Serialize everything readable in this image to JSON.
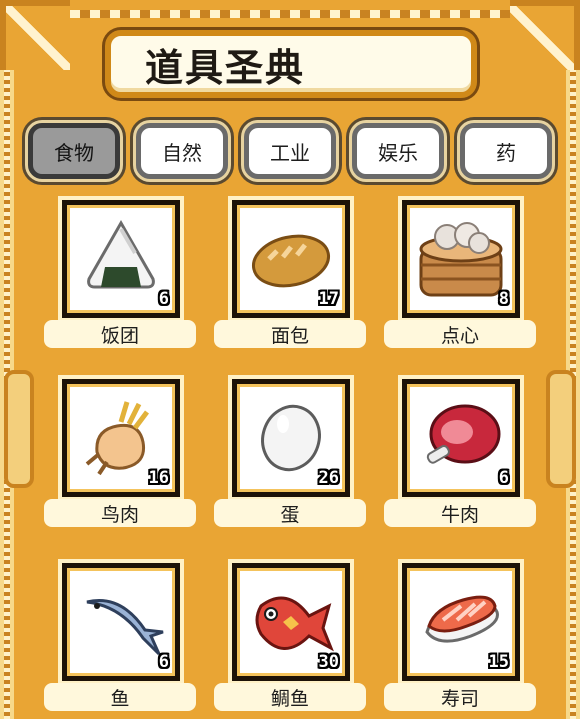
{
  "title": "道具圣典",
  "tabs": [
    {
      "label": "食物",
      "active": true
    },
    {
      "label": "自然",
      "active": false
    },
    {
      "label": "工业",
      "active": false
    },
    {
      "label": "娱乐",
      "active": false
    },
    {
      "label": "药",
      "active": false
    }
  ],
  "items": [
    {
      "name": "饭团",
      "count": "6",
      "icon": "rice-ball-icon"
    },
    {
      "name": "面包",
      "count": "17",
      "icon": "bread-icon"
    },
    {
      "name": "点心",
      "count": "8",
      "icon": "dim-sum-steamer-icon"
    },
    {
      "name": "鸟肉",
      "count": "16",
      "icon": "chicken-icon"
    },
    {
      "name": "蛋",
      "count": "26",
      "icon": "egg-icon"
    },
    {
      "name": "牛肉",
      "count": "6",
      "icon": "beef-icon"
    },
    {
      "name": "鱼",
      "count": "6",
      "icon": "fish-icon"
    },
    {
      "name": "鲷鱼",
      "count": "30",
      "icon": "sea-bream-icon"
    },
    {
      "name": "寿司",
      "count": "15",
      "icon": "sushi-icon"
    }
  ],
  "colors": {
    "background": "#e9a534",
    "frame": "#c9831f",
    "label_bg": "#fff8dc",
    "active_tab": "#9a9a9a"
  }
}
